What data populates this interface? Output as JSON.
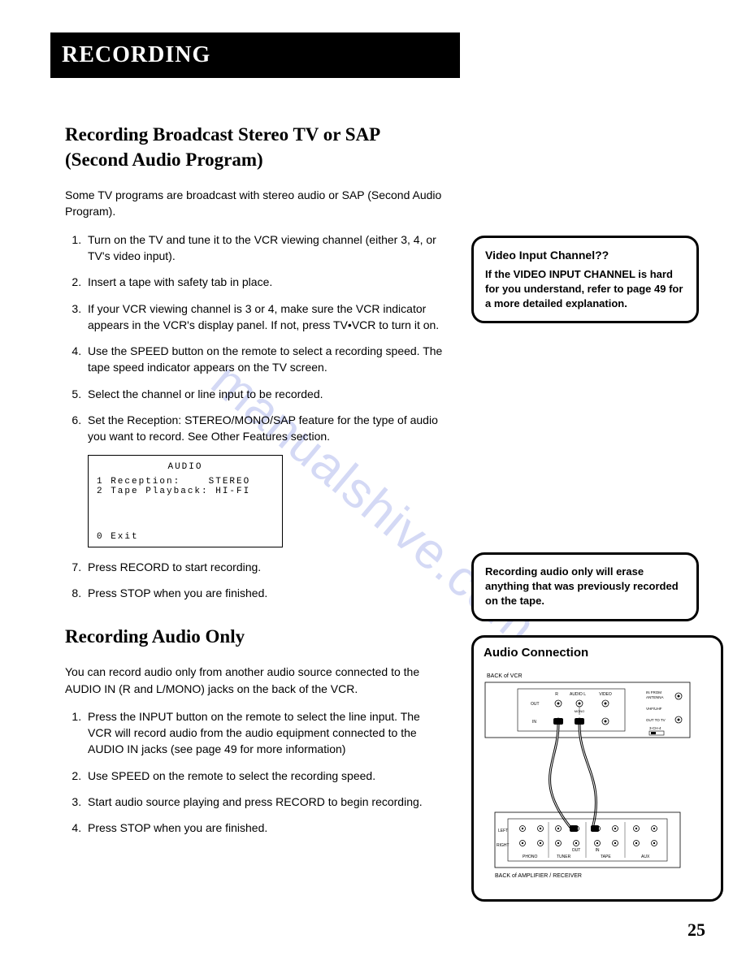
{
  "header": "RECORDING",
  "section1": {
    "title": "Recording Broadcast Stereo TV or SAP (Second Audio Program)",
    "intro": "Some TV programs are broadcast with stereo audio or SAP (Second Audio Program).",
    "steps": [
      "Turn on the TV and tune it to the VCR viewing channel (either 3, 4, or TV's video input).",
      "Insert a tape with safety tab in place.",
      "If your VCR viewing channel is 3 or 4, make sure the VCR indicator appears in the VCR's display panel. If not, press TV•VCR to turn it on.",
      "Use the SPEED button on the remote to select a recording speed. The tape speed indicator appears on the TV screen.",
      "Select the channel or line input to be recorded.",
      "Set the Reception: STEREO/MONO/SAP feature for the type of audio you want to record. See Other Features section.",
      "Press RECORD to start recording.",
      "Press STOP when you are finished."
    ]
  },
  "audio_panel": {
    "title": "AUDIO",
    "line1": "1 Reception:    STEREO",
    "line2": "2 Tape Playback: HI-FI",
    "exit": "0 Exit"
  },
  "section2": {
    "title": "Recording Audio Only",
    "intro": "You can record audio only from another audio source connected to the AUDIO IN (R and L/MONO) jacks on the back of the VCR.",
    "steps": [
      "Press the INPUT button on the remote to select the line input.  The VCR will record audio from the audio equipment connected to the AUDIO IN jacks (see page 49 for more information)",
      "Use SPEED on the remote to select the recording speed.",
      "Start audio source playing and press RECORD to begin recording.",
      "Press STOP when you are finished."
    ]
  },
  "callout1": {
    "title": "Video Input Channel??",
    "body": "If the VIDEO INPUT CHANNEL is hard for you understand, refer  to page 49 for a more detailed explanation."
  },
  "callout2": {
    "body": "Recording audio only will erase anything that was previously recorded on the tape."
  },
  "diagram": {
    "title": "Audio Connection",
    "back_vcr": "BACK of VCR",
    "back_amp": "BACK of AMPLIFIER / RECEIVER",
    "labels": {
      "out": "OUT",
      "in": "IN",
      "r": "R",
      "audio_l": "AUDIO  L",
      "video": "VIDEO",
      "mono": "MONO",
      "in_from_antenna": "IN FROM ANTENNA",
      "vhf_uhf": "VHF/UHF",
      "out_to_tv": "OUT TO TV",
      "ch34": "3-CH-4",
      "left": "LEFT",
      "right": "RIGHT",
      "phono": "PHONO",
      "tuner": "TUNER",
      "tape": "TAPE",
      "aux": "AUX",
      "out2": "OUT",
      "in2": "IN"
    }
  },
  "page_number": "25",
  "watermark": "manualshive.com"
}
